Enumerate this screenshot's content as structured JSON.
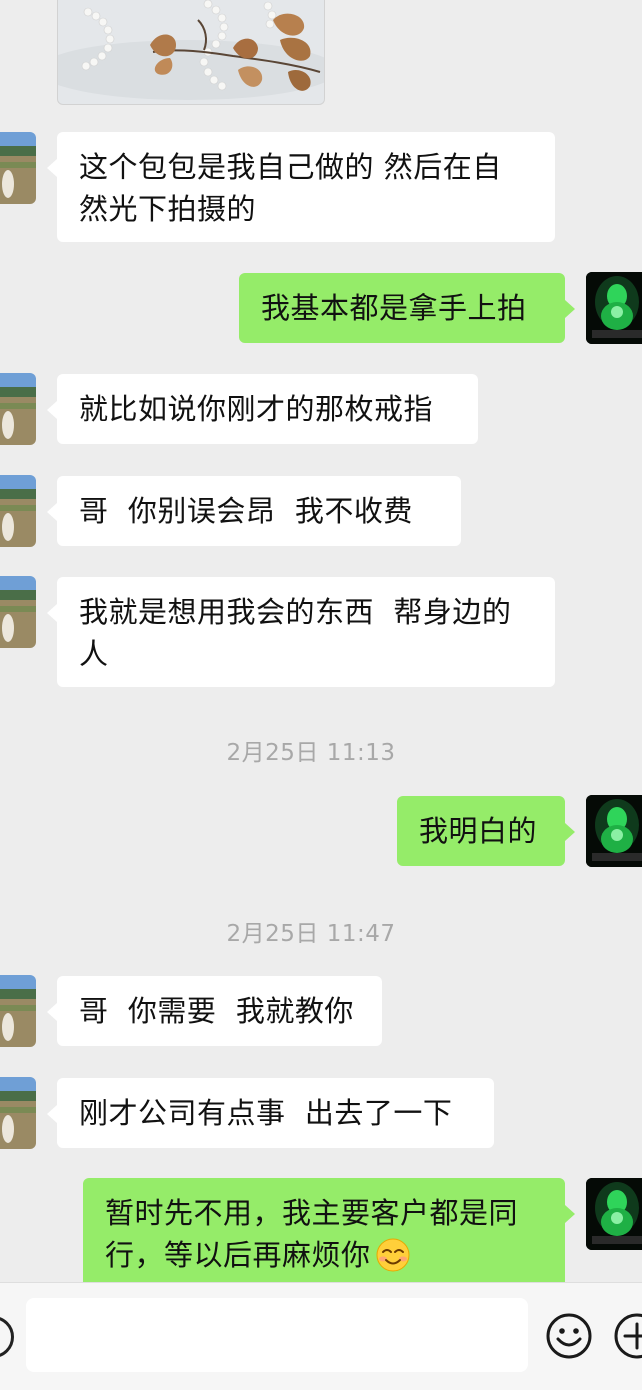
{
  "messages": [
    {
      "text_lines": [
        "这个包包是我自己做的 然后在自",
        "然光下拍摄的"
      ]
    },
    {
      "text_lines": [
        "我基本都是拿手上拍"
      ]
    },
    {
      "text_lines": [
        "就比如说你刚才的那枚戒指"
      ]
    },
    {
      "text_lines": [
        "哥  你别误会昂  我不收费"
      ]
    },
    {
      "text_lines": [
        "我就是想用我会的东西  帮身边的",
        "人"
      ]
    },
    {
      "text_lines": [
        "我明白的"
      ]
    },
    {
      "text_lines": [
        "哥  你需要  我就教你"
      ]
    },
    {
      "text_lines": [
        "刚才公司有点事  出去了一下"
      ]
    },
    {
      "text_lines": [
        "暂时先不用，我主要客户都是同",
        "行，等以后再麻烦你"
      ]
    }
  ],
  "timestamps": [
    "2月25日 11:13",
    "2月25日 11:47"
  ],
  "colors": {
    "background": "#ededed",
    "bubble_incoming": "#ffffff",
    "bubble_outgoing": "#95ec69",
    "timestamp": "#a8a8a8"
  },
  "icons": [
    "voice-icon",
    "emoji-icon",
    "plus-icon",
    "smile-emoji"
  ]
}
